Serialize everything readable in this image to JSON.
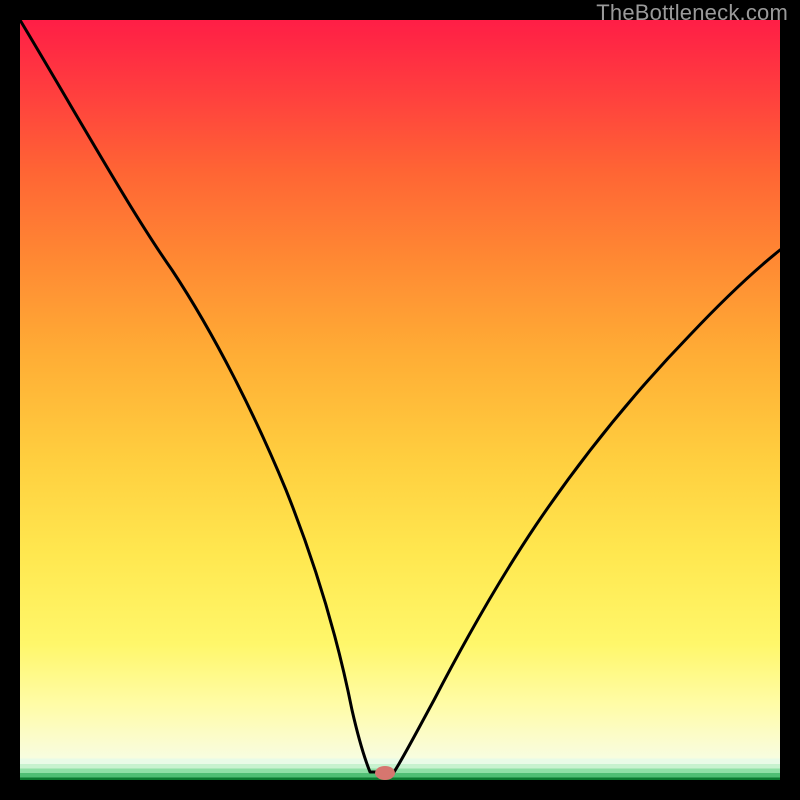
{
  "watermark": "TheBottleneck.com",
  "chart_data": {
    "type": "line",
    "title": "",
    "xlabel": "",
    "ylabel": "",
    "xlim": [
      0,
      100
    ],
    "ylim": [
      0,
      100
    ],
    "grid": false,
    "legend": null,
    "series": [
      {
        "name": "bottleneck-curve",
        "x": [
          0,
          5,
          10,
          15,
          20,
          25,
          30,
          35,
          40,
          43,
          45,
          47,
          49,
          54,
          60,
          66,
          72,
          78,
          84,
          90,
          96,
          100
        ],
        "values": [
          100,
          89,
          78,
          67,
          56,
          45,
          34,
          23,
          12,
          4,
          1,
          0,
          0,
          4,
          10,
          17,
          25,
          33,
          42,
          51,
          60,
          66
        ]
      }
    ],
    "marker": {
      "x": 48,
      "y": 0.4,
      "color": "#d6766f"
    },
    "background_bands": [
      {
        "from": 0.0,
        "to": 0.35,
        "color": "#0a7a2f"
      },
      {
        "from": 0.35,
        "to": 0.9,
        "color": "#4fbf74"
      },
      {
        "from": 0.9,
        "to": 1.5,
        "color": "#8fe0a6"
      },
      {
        "from": 1.5,
        "to": 2.1,
        "color": "#c7f2cf"
      },
      {
        "from": 2.1,
        "to": 2.8,
        "color": "#e9fbe7"
      },
      {
        "from": 2.8,
        "to": 100,
        "color": "gradient:yellow-to-red"
      }
    ]
  }
}
